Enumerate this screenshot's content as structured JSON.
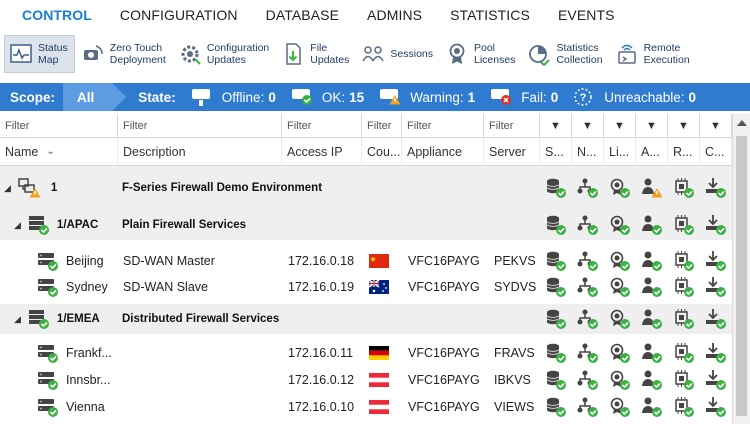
{
  "tabs": [
    "CONTROL",
    "CONFIGURATION",
    "DATABASE",
    "ADMINS",
    "STATISTICS",
    "EVENTS"
  ],
  "active_tab": "CONTROL",
  "toolbar": [
    {
      "label": "Status\nMap",
      "icon": "status-map-icon",
      "active": true
    },
    {
      "label": "Zero Touch\nDeployment",
      "icon": "zero-touch-icon"
    },
    {
      "label": "Configuration\nUpdates",
      "icon": "configuration-updates-icon"
    },
    {
      "label": "File\nUpdates",
      "icon": "file-updates-icon"
    },
    {
      "label": "Sessions",
      "icon": "sessions-icon"
    },
    {
      "label": "Pool\nLicenses",
      "icon": "pool-licenses-icon"
    },
    {
      "label": "Statistics\nCollection",
      "icon": "statistics-collection-icon"
    },
    {
      "label": "Remote\nExecution",
      "icon": "remote-execution-icon"
    }
  ],
  "scope": {
    "scope_label": "Scope:",
    "scope_value": "All",
    "state_label": "State:",
    "states": [
      {
        "label": "Offline:",
        "count": "0",
        "icon": "offline-icon"
      },
      {
        "label": "OK:",
        "count": "15",
        "icon": "ok-icon"
      },
      {
        "label": "Warning:",
        "count": "1",
        "icon": "warning-icon"
      },
      {
        "label": "Fail:",
        "count": "0",
        "icon": "fail-icon"
      },
      {
        "label": "Unreachable:",
        "count": "0",
        "icon": "unreachable-icon"
      }
    ]
  },
  "filter_placeholder": "Filter",
  "columns": [
    "Name",
    "Description",
    "Access IP",
    "Cou...",
    "Appliance",
    "Server",
    "S...",
    "N...",
    "Li...",
    "A...",
    "R...",
    "C..."
  ],
  "rows": [
    {
      "type": "group",
      "level": 0,
      "name": "1",
      "description": "F-Series Firewall Demo Environment",
      "icon": "range-warning-icon",
      "statuses": [
        "ok",
        "ok",
        "ok",
        "warning",
        "ok",
        "ok"
      ]
    },
    {
      "type": "group",
      "level": 1,
      "name": "1/APAC",
      "description": "Plain Firewall Services",
      "icon": "cluster-ok-icon",
      "statuses": [
        "ok",
        "ok",
        "ok",
        "ok",
        "ok",
        "ok"
      ]
    },
    {
      "type": "node",
      "name": "Beijing",
      "description": "SD-WAN Master",
      "ip": "172.16.0.18",
      "country": "china-flag",
      "appliance": "VFC16PAYG",
      "server": "PEKVS",
      "statuses": [
        "ok",
        "ok",
        "ok",
        "ok",
        "ok",
        "ok"
      ]
    },
    {
      "type": "node",
      "name": "Sydney",
      "description": "SD-WAN Slave",
      "ip": "172.16.0.19",
      "country": "australia-flag",
      "appliance": "VFC16PAYG",
      "server": "SYDVS",
      "statuses": [
        "ok",
        "ok",
        "ok",
        "ok",
        "ok",
        "ok"
      ]
    },
    {
      "type": "group",
      "level": 1,
      "name": "1/EMEA",
      "description": "Distributed Firewall Services",
      "icon": "cluster-ok-icon",
      "statuses": [
        "ok",
        "ok",
        "ok",
        "ok",
        "ok",
        "ok"
      ]
    },
    {
      "type": "node",
      "name": "Frankf...",
      "description": "",
      "ip": "172.16.0.11",
      "country": "germany-flag",
      "appliance": "VFC16PAYG",
      "server": "FRAVS",
      "statuses": [
        "ok",
        "ok",
        "ok",
        "ok",
        "ok",
        "ok"
      ]
    },
    {
      "type": "node",
      "name": "Innsbr...",
      "description": "",
      "ip": "172.16.0.12",
      "country": "austria-flag",
      "appliance": "VFC16PAYG",
      "server": "IBKVS",
      "statuses": [
        "ok",
        "ok",
        "ok",
        "ok",
        "ok",
        "ok"
      ]
    },
    {
      "type": "node",
      "name": "Vienna",
      "description": "",
      "ip": "172.16.0.10",
      "country": "austria-flag",
      "appliance": "VFC16PAYG",
      "server": "VIEWS",
      "statuses": [
        "ok",
        "ok",
        "ok",
        "ok",
        "ok",
        "ok"
      ]
    }
  ],
  "colors": {
    "accent": "#1a7fd4",
    "scope_bar": "#2e7bd0",
    "ok": "#3cb043",
    "warning": "#f0a020",
    "fail": "#d9302c",
    "group_bg": "#efefef"
  }
}
